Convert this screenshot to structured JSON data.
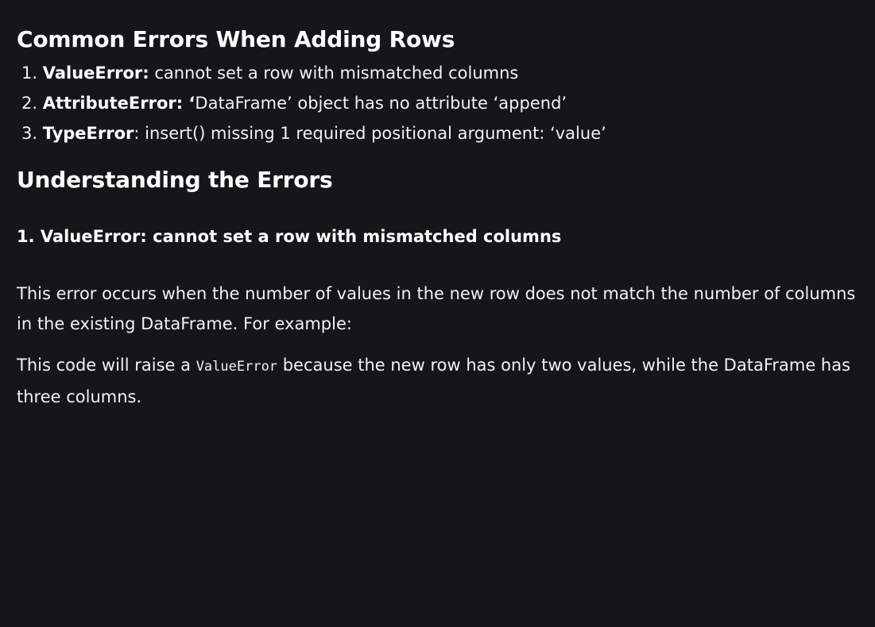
{
  "section1": {
    "heading": "Common Errors When Adding Rows",
    "items": [
      {
        "num": "1.",
        "label": "ValueError:",
        "text": " cannot set a row with mismatched columns"
      },
      {
        "num": "2.",
        "label": "AttributeError: ‘",
        "text": "DataFrame’ object has no attribute ‘append’"
      },
      {
        "num": "3.",
        "label": "TypeError",
        "text": ": insert() missing 1 required positional argument: ‘value’"
      }
    ]
  },
  "section2": {
    "heading": "Understanding the Errors",
    "subheading": "1. ValueError: cannot set a row with mismatched columns",
    "paragraph1": "This error occurs when the number of values in the new row does not match the number of columns in the existing DataFrame. For example:",
    "paragraph2_before": "This code will raise a ",
    "paragraph2_code": "ValueError",
    "paragraph2_after": " because the new row has only two values, while the DataFrame has three columns."
  }
}
